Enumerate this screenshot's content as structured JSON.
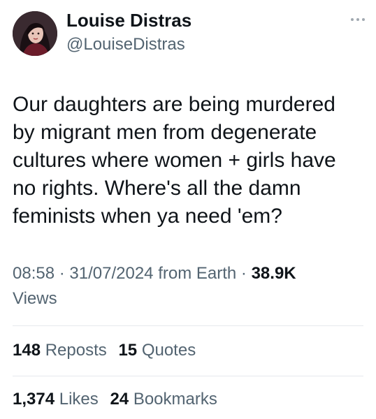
{
  "author": {
    "display_name": "Louise Distras",
    "handle": "@LouiseDistras",
    "avatar_icon": "profile-photo"
  },
  "tweet": {
    "text": "Our daughters are being murdered\nby migrant men from degenerate\ncultures where women + girls have\nno rights. Where's all the damn\nfeminists when ya need 'em?",
    "time": "08:58",
    "separator": "·",
    "date": "31/07/2024",
    "source": "from Earth",
    "views_count": "38.9K",
    "views_label": "Views"
  },
  "stats": {
    "reposts_count": "148",
    "reposts_label": "Reposts",
    "quotes_count": "15",
    "quotes_label": "Quotes",
    "likes_count": "1,374",
    "likes_label": "Likes",
    "bookmarks_count": "24",
    "bookmarks_label": "Bookmarks"
  },
  "icons": {
    "more": "more-dots-icon"
  },
  "colors": {
    "primary_text": "#0f1419",
    "secondary_text": "#536471",
    "divider": "#e6e9ec"
  }
}
